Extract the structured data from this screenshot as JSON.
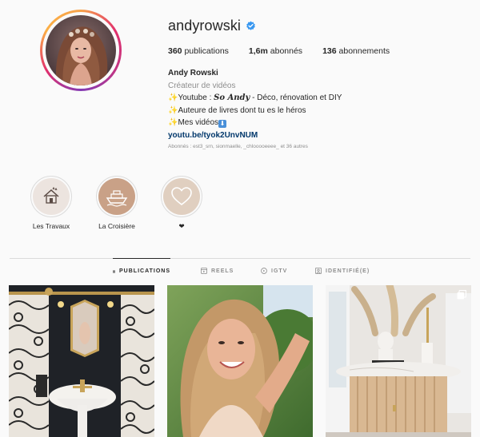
{
  "profile": {
    "username": "andyrowski",
    "verified": true
  },
  "stats": {
    "posts_count": "360",
    "posts_label": "publications",
    "followers_count": "1,6m",
    "followers_label": "abonnés",
    "following_count": "136",
    "following_label": "abonnements"
  },
  "bio": {
    "full_name": "Andy Rowski",
    "category": "Créateur de vidéos",
    "line1_prefix": "Youtube : ",
    "line1_fancy": "So Andy",
    "line1_suffix": " - Déco, rénovation et DIY",
    "line2": "Auteure de livres dont tu es le héros",
    "line3": "Mes vidéos",
    "link": "youtu.be/tyok2UnvNUM"
  },
  "followed_by": "Abonnés : est3_srn, sionmaelle, _chlooooeeee_ et 36 autres",
  "highlights": [
    {
      "label": "Les Travaux",
      "icon": "house-icon"
    },
    {
      "label": "La Croisière",
      "icon": "ship-icon"
    },
    {
      "label": "❤",
      "icon": "heart-icon"
    }
  ],
  "tabs": [
    {
      "label": "PUBLICATIONS",
      "icon": "grid-icon",
      "active": true
    },
    {
      "label": "REELS",
      "icon": "reels-icon",
      "active": false
    },
    {
      "label": "IGTV",
      "icon": "igtv-icon",
      "active": false
    },
    {
      "label": "IDENTIFIÉ(E)",
      "icon": "tagged-icon",
      "active": false
    }
  ],
  "posts": [
    {
      "subject": "bathroom-photo",
      "multi": false
    },
    {
      "subject": "selfie-photo",
      "multi": false
    },
    {
      "subject": "table-decor-photo",
      "multi": true
    }
  ],
  "colors": {
    "verified": "#3897f0",
    "link": "#00376b",
    "muted": "#8e8e8e",
    "border": "#dbdbdb",
    "highlight_travaux": "#ece4df",
    "highlight_croisiere": "#c9a187",
    "highlight_heart": "#e0cfc0"
  }
}
